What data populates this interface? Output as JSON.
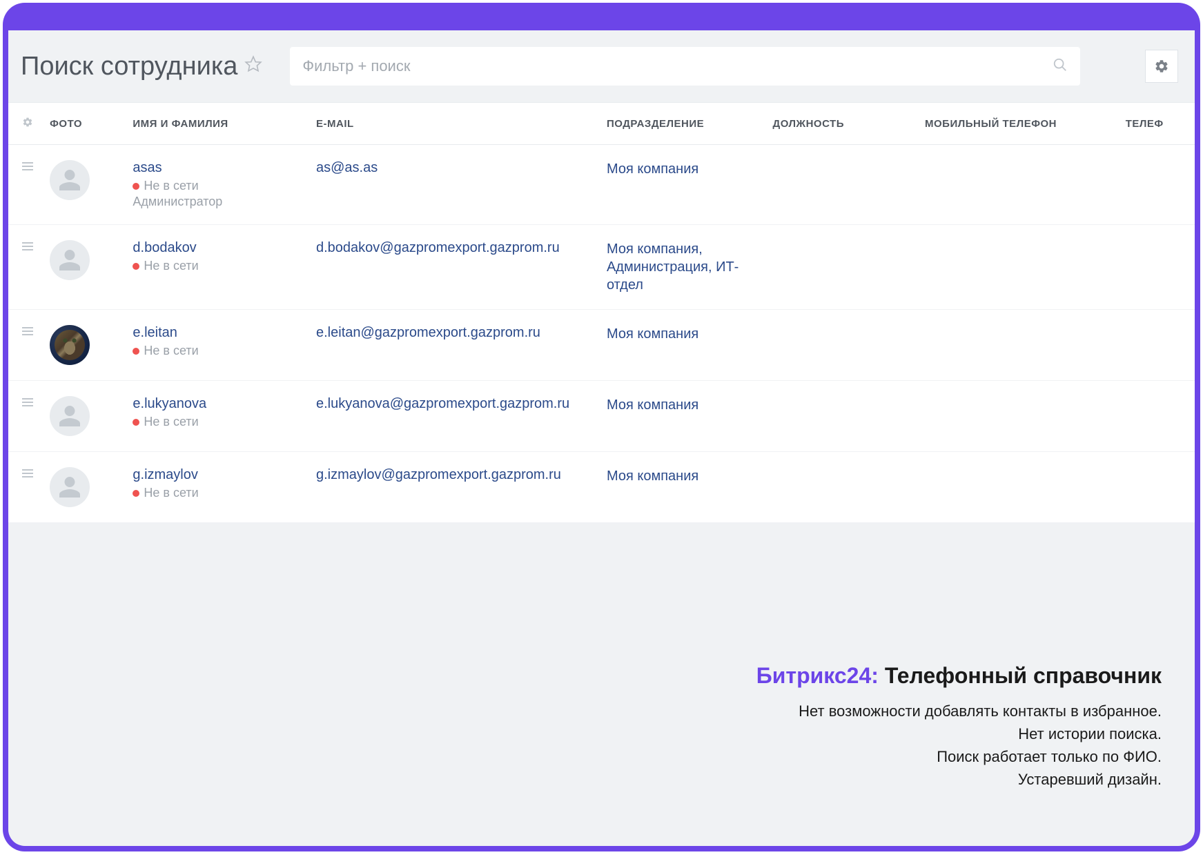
{
  "header": {
    "title": "Поиск сотрудника",
    "search_placeholder": "Фильтр + поиск"
  },
  "columns": {
    "photo": "ФОТО",
    "name": "ИМЯ И ФАМИЛИЯ",
    "email": "E-MAIL",
    "department": "ПОДРАЗДЕЛЕНИЕ",
    "position": "ДОЛЖНОСТЬ",
    "mobile": "МОБИЛЬНЫЙ ТЕЛЕФОН",
    "phone": "ТЕЛЕФ"
  },
  "status_label": "Не в сети",
  "rows": [
    {
      "name": "asas",
      "status": "Не в сети",
      "role": "Администратор",
      "email": "as@as.as",
      "department": "Моя компания",
      "has_photo": false
    },
    {
      "name": "d.bodakov",
      "status": "Не в сети",
      "role": "",
      "email": "d.bodakov@gazpromexport.gazprom.ru",
      "department": "Моя компания, Администрация, ИТ-отдел",
      "has_photo": false
    },
    {
      "name": "e.leitan",
      "status": "Не в сети",
      "role": "",
      "email": "e.leitan@gazpromexport.gazprom.ru",
      "department": "Моя компания",
      "has_photo": true
    },
    {
      "name": "e.lukyanova",
      "status": "Не в сети",
      "role": "",
      "email": "e.lukyanova@gazpromexport.gazprom.ru",
      "department": "Моя компания",
      "has_photo": false
    },
    {
      "name": "g.izmaylov",
      "status": "Не в сети",
      "role": "",
      "email": "g.izmaylov@gazpromexport.gazprom.ru",
      "department": "Моя компания",
      "has_photo": false
    }
  ],
  "annotation": {
    "brand": "Битрикс24:",
    "title": "Телефонный справочник",
    "lines": [
      "Нет возможности добавлять контакты в избранное.",
      "Нет истории поиска.",
      "Поиск работает только по ФИО.",
      "Устаревший дизайн."
    ]
  }
}
